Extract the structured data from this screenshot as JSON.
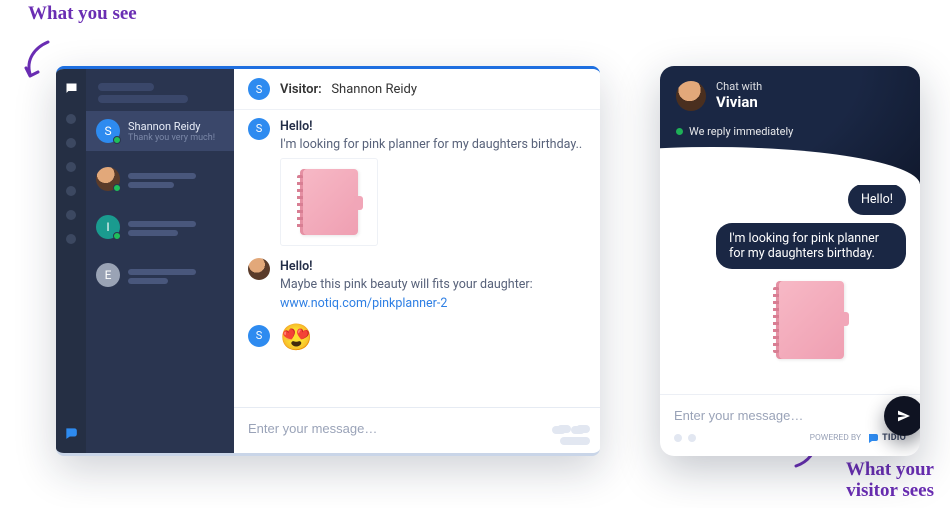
{
  "annotations": {
    "left": "What you see",
    "right_l1": "What your",
    "right_l2": "visitor sees"
  },
  "operator": {
    "header": {
      "label": "Visitor:",
      "name": "Shannon Reidy"
    },
    "sidebar": {
      "active": {
        "name": "Shannon Reidy",
        "sub": "Thank you very much!"
      },
      "avatars": {
        "i": "I",
        "e": "E"
      }
    },
    "messages": {
      "m1": {
        "t1": "Hello!",
        "t2": "I'm looking for pink planner for my daughters birthday.."
      },
      "m2": {
        "t1": "Hello!",
        "t2": "Maybe this pink beauty will fits your daughter:",
        "link": "www.notiq.com/pinkplanner-2"
      },
      "m3": {
        "emoji": "😍"
      }
    },
    "input": {
      "placeholder": "Enter your message…"
    }
  },
  "visitor": {
    "header": {
      "l1": "Chat with",
      "l2": "Vivian"
    },
    "reply": "We reply immediately",
    "bubbles": {
      "b1": "Hello!",
      "b2": "I'm looking for pink planner for my daughters birthday."
    },
    "input": {
      "placeholder": "Enter your message…"
    },
    "powered": "POWERED BY",
    "brand": "TIDIO"
  }
}
